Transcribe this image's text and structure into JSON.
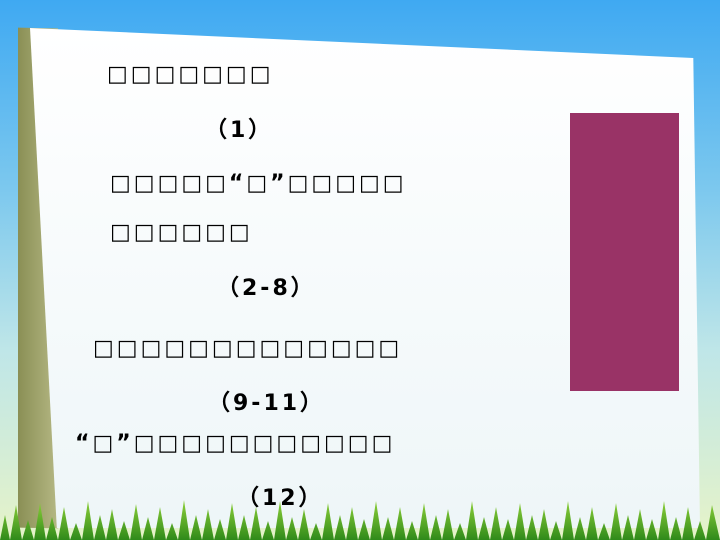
{
  "lines": [
    "□□□□□□□",
    "（1）",
    "□□□□□“□”□□□□□",
    "□□□□□□",
    "（2-8）",
    "□□□□□□□□□□□□□",
    "（9-11）",
    "“□”□□□□□□□□□□□",
    "（12）"
  ],
  "colors": {
    "block": "#993366"
  }
}
